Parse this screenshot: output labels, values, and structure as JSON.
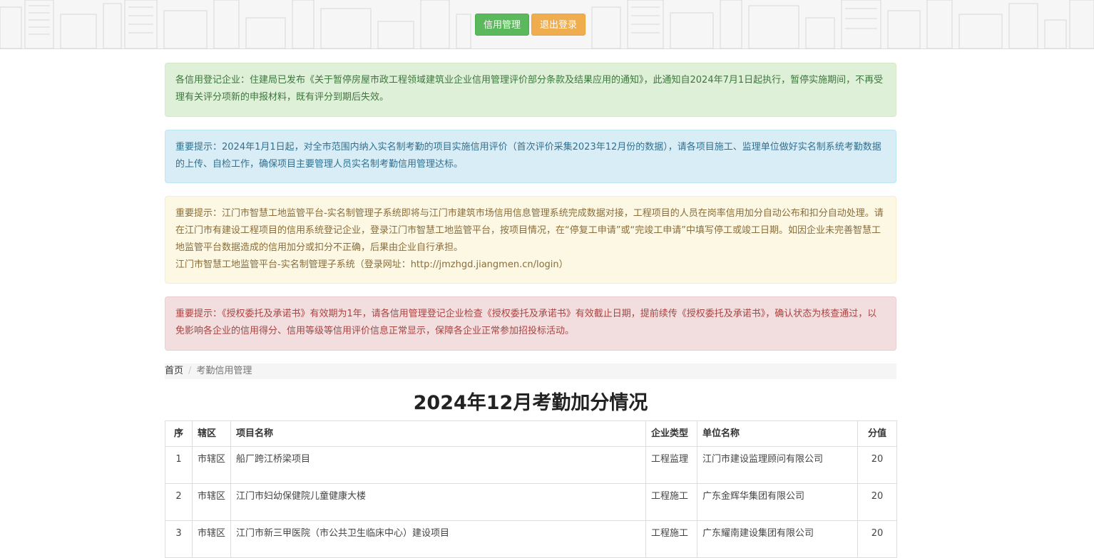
{
  "header": {
    "credit_button": "信用管理",
    "logout_button": "退出登录",
    "colors": {
      "green": "#5cb85c",
      "orange": "#f0ad4e"
    }
  },
  "notices": {
    "success": "各信用登记企业：住建局已发布《关于暂停房屋市政工程领域建筑业企业信用管理评价部分条款及结果应用的通知》，此通知自2024年7月1日起执行，暂停实施期间，不再受理有关评分项新的申报材料，既有评分到期后失效。",
    "info": "重要提示：2024年1月1日起，对全市范围内纳入实名制考勤的项目实施信用评价（首次评价采集2023年12月份的数据），请各项目施工、监理单位做好实名制系统考勤数据的上传、自检工作，确保项目主要管理人员实名制考勤信用管理达标。",
    "warning_p1": "重要提示：江门市智慧工地监管平台-实名制管理子系统即将与江门市建筑市场信用信息管理系统完成数据对接，工程项目的人员在岗率信用加分自动公布和扣分自动处理。请在江门市有建设工程项目的信用系统登记企业，登录江门市智慧工地监管平台，按项目情况，在“停复工申请”或“完竣工申请”中填写停工或竣工日期。如因企业未完善智慧工地监管平台数据造成的信用加分或扣分不正确，后果由企业自行承担。",
    "warning_p2": "江门市智慧工地监管平台-实名制管理子系统（登录网址：http://jmzhgd.jiangmen.cn/login）",
    "danger": "重要提示：《授权委托及承诺书》有效期为1年，请各信用管理登记企业检查《授权委托及承诺书》有效截止日期，提前续传《授权委托及承诺书》，确认状态为核查通过，以免影响各企业的信用得分、信用等级等信用评价信息正常显示，保障各企业正常参加招投标活动。"
  },
  "breadcrumb": {
    "home": "首页",
    "separator": "/",
    "current": "考勤信用管理"
  },
  "page_title": "2024年12月考勤加分情况",
  "table": {
    "headers": [
      "序",
      "辖区",
      "项目名称",
      "企业类型",
      "单位名称",
      "分值"
    ],
    "rows": [
      [
        "1",
        "市辖区",
        "船厂跨江桥梁项目",
        "工程监理",
        "江门市建设监理顾问有限公司",
        "20"
      ],
      [
        "2",
        "市辖区",
        "江门市妇幼保健院儿童健康大楼",
        "工程施工",
        "广东金辉华集团有限公司",
        "20"
      ],
      [
        "3",
        "市辖区",
        "江门市新三甲医院（市公共卫生临床中心）建设项目",
        "工程施工",
        "广东耀南建设集团有限公司",
        "20"
      ]
    ]
  }
}
